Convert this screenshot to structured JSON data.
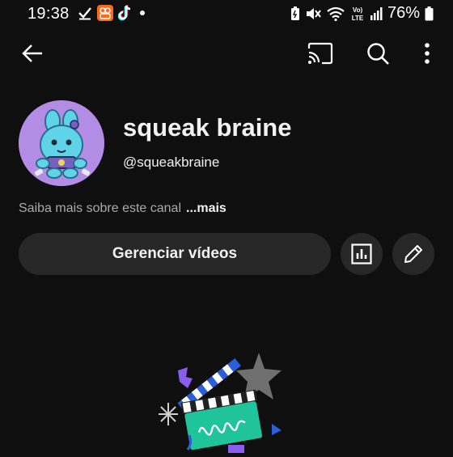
{
  "status_bar": {
    "time": "19:38",
    "battery": "76%",
    "left_icons": [
      "check-icon",
      "kwai-app-icon",
      "tiktok-icon",
      "dot-icon"
    ],
    "right_icons": [
      "battery-saver-icon",
      "mute-icon",
      "wifi-icon",
      "volte-icon",
      "signal-icon",
      "battery-icon"
    ]
  },
  "topbar": {
    "icons": [
      "back-arrow-icon",
      "cast-icon",
      "search-icon",
      "more-vert-icon"
    ]
  },
  "channel": {
    "name": "squeak braine",
    "handle": "@squeakbraine",
    "about_text": "Saiba mais sobre este canal",
    "about_more": "...mais"
  },
  "actions": {
    "manage_videos": "Gerenciar vídeos",
    "icons": [
      "analytics-icon",
      "edit-pencil-icon"
    ]
  },
  "colors": {
    "background": "#0f0f0f",
    "button_bg": "#272727",
    "text_primary": "#f1f1f1",
    "text_secondary": "#aaaaaa",
    "avatar_bg": "#b38ce6"
  }
}
